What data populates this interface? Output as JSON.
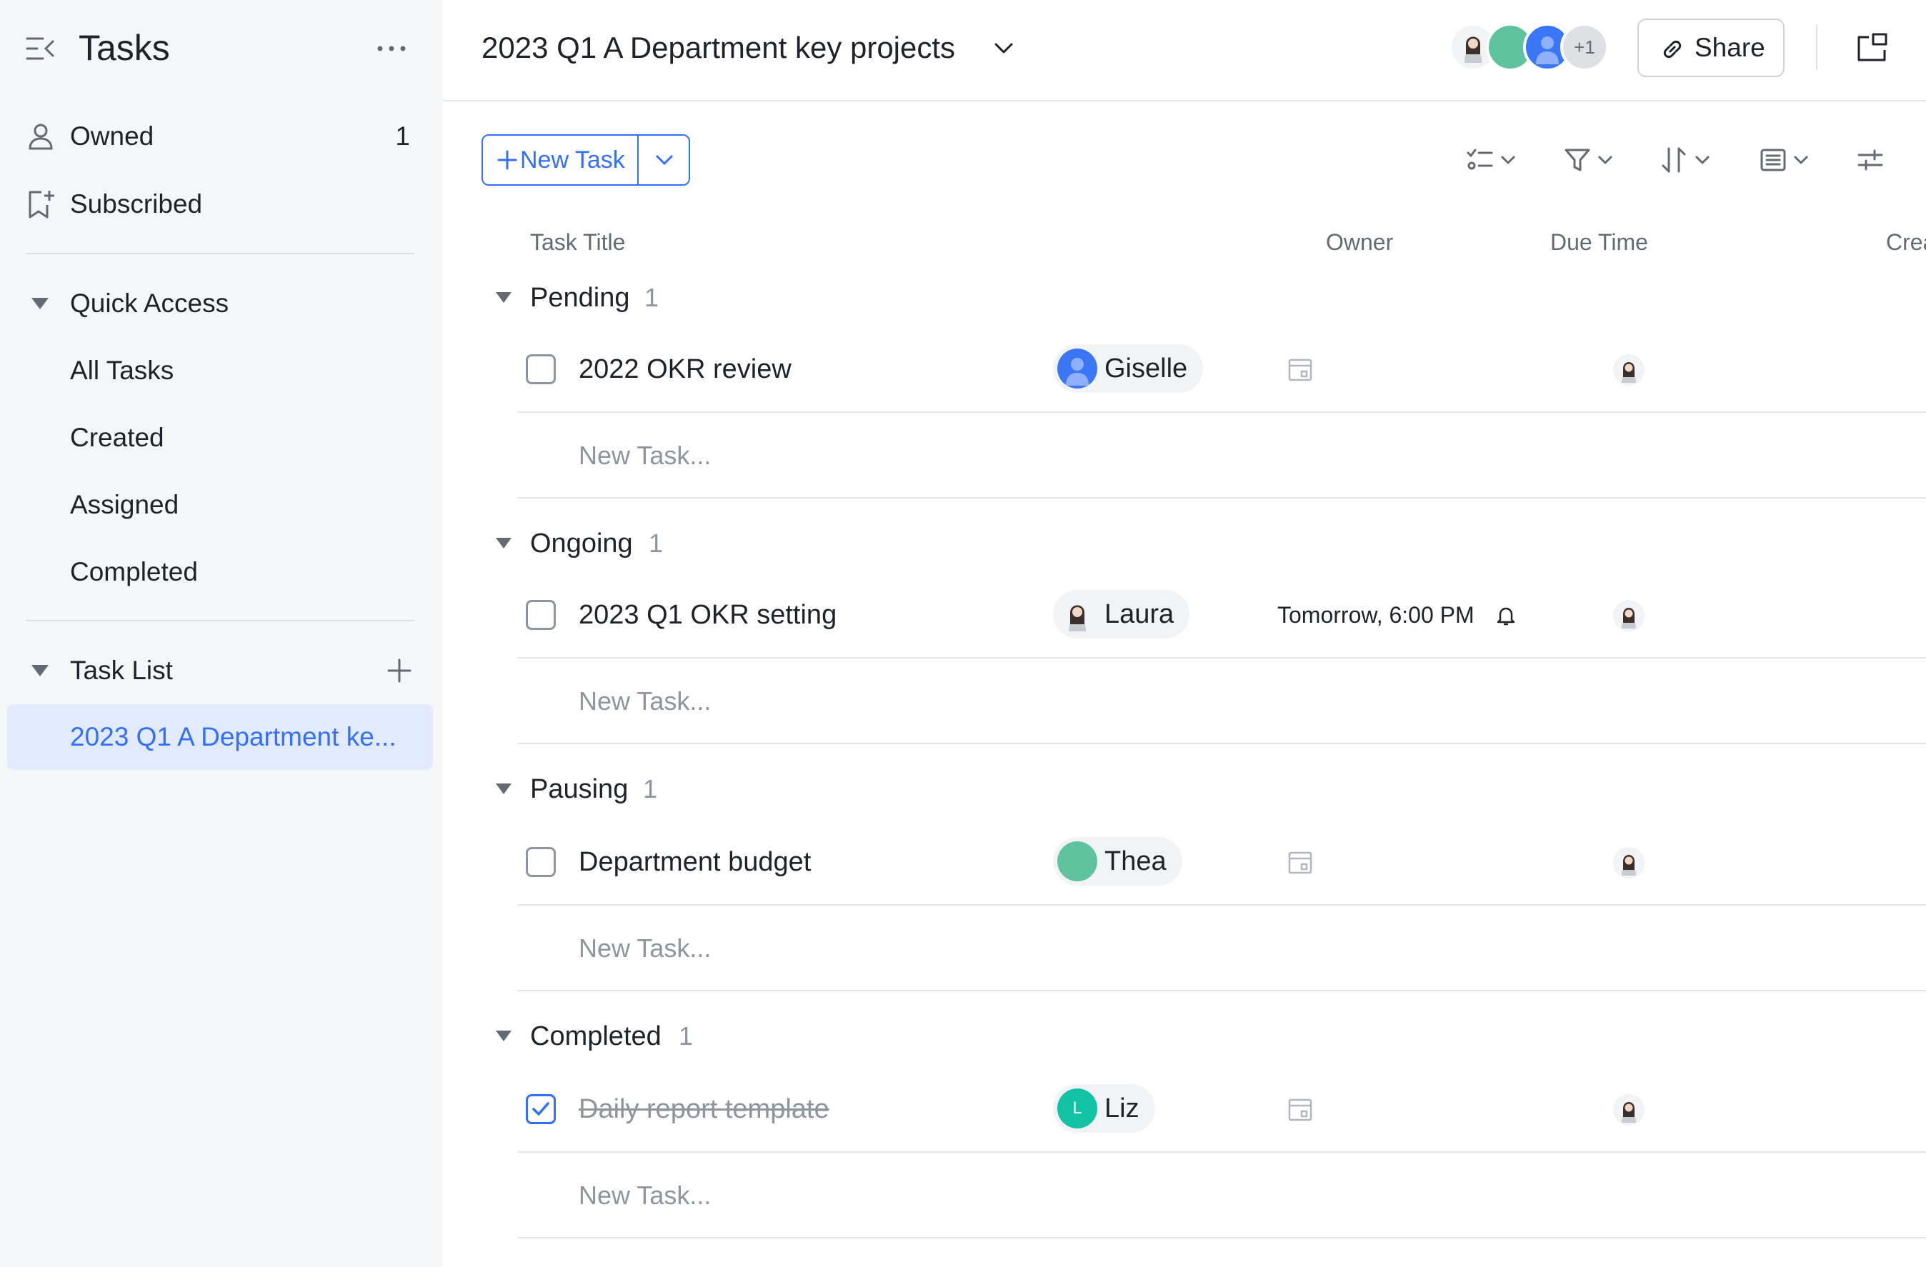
{
  "sidebar": {
    "title": "Tasks",
    "owned": {
      "label": "Owned",
      "count": "1"
    },
    "subscribed": {
      "label": "Subscribed"
    },
    "quick_access": {
      "label": "Quick Access",
      "items": [
        {
          "label": "All Tasks"
        },
        {
          "label": "Created"
        },
        {
          "label": "Assigned"
        },
        {
          "label": "Completed"
        }
      ]
    },
    "task_list": {
      "label": "Task List",
      "items": [
        {
          "label": "2023 Q1 A Department ke..."
        }
      ]
    }
  },
  "header": {
    "title": "2023 Q1 A Department key projects",
    "more_members": "+1",
    "share_label": "Share"
  },
  "toolbar": {
    "new_task_label": "New Task"
  },
  "columns": {
    "task_title": "Task Title",
    "owner": "Owner",
    "due_time": "Due Time",
    "creator_partial": "Crea"
  },
  "groups": [
    {
      "name": "Pending",
      "count": "1",
      "tasks": [
        {
          "title": "2022 OKR review",
          "owner": "Giselle",
          "due": "",
          "completed": false
        }
      ],
      "new_task_placeholder": "New Task..."
    },
    {
      "name": "Ongoing",
      "count": "1",
      "tasks": [
        {
          "title": "2023 Q1 OKR setting",
          "owner": "Laura",
          "due": "Tomorrow, 6:00 PM",
          "completed": false
        }
      ],
      "new_task_placeholder": "New Task..."
    },
    {
      "name": "Pausing",
      "count": "1",
      "tasks": [
        {
          "title": "Department budget",
          "owner": "Thea",
          "due": "",
          "completed": false
        }
      ],
      "new_task_placeholder": "New Task..."
    },
    {
      "name": "Completed",
      "count": "1",
      "tasks": [
        {
          "title": "Daily report template",
          "owner": "Liz",
          "owner_initial": "L",
          "due": "",
          "completed": true
        }
      ],
      "new_task_placeholder": "New Task..."
    }
  ],
  "colors": {
    "accent": "#3370ff",
    "sidebar_bg": "#f5f6f7",
    "active_bg": "#e1eaff",
    "avatar_green": "#5fc3a0",
    "avatar_blue": "#3b76f6",
    "avatar_teal": "#12c2a5"
  }
}
